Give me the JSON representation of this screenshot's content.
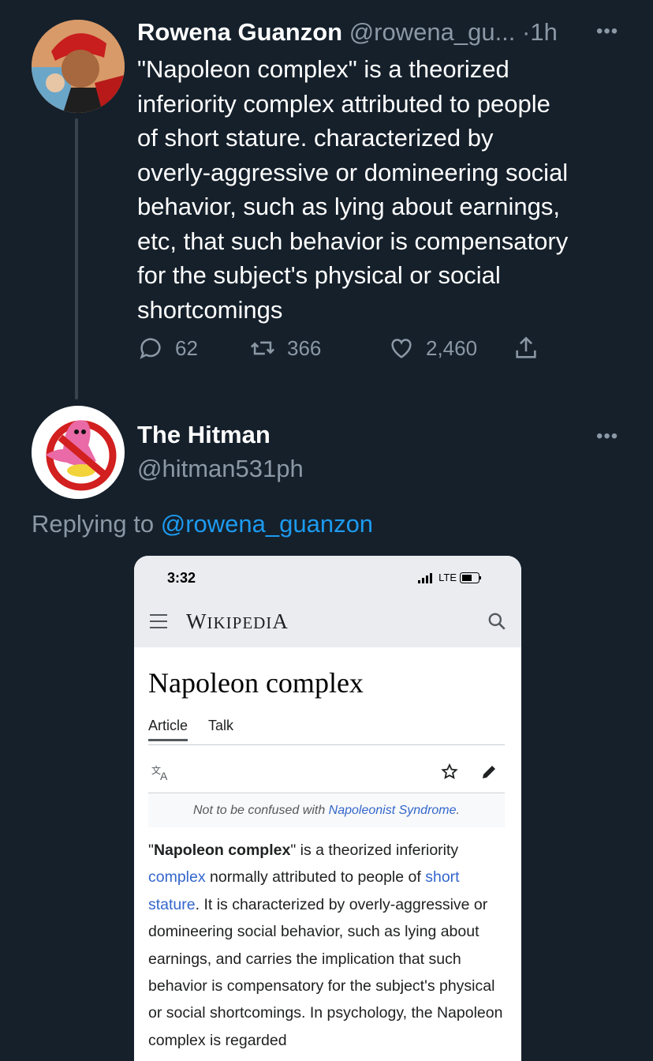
{
  "tweet": {
    "author_name": "Rowena Guanzon",
    "author_handle": "@rowena_gu...",
    "separator": "·",
    "time": "1h",
    "more": "•••",
    "text": "\"Napoleon complex\" is a theorized\ninferiority complex attributed to people\nof short stature.  characterized by\noverly-aggressive or domineering social\nbehavior, such as lying about earnings,\netc, that such behavior is compensatory\nfor the subject's physical or social\nshortcomings",
    "actions": {
      "replies": "62",
      "retweets": "366",
      "likes": "2,460"
    }
  },
  "reply": {
    "author_name": "The Hitman",
    "author_handle": "@hitman531ph",
    "more": "•••",
    "replying_prefix": "Replying to",
    "replying_handle": "@rowena_guanzon"
  },
  "embedded_screenshot": {
    "status_time": "3:32",
    "network": "LTE",
    "wiki_logo_first": "W",
    "wiki_logo_rest": "IKIPEDI",
    "wiki_logo_last": "A",
    "article_title": "Napoleon complex",
    "tabs": [
      "Article",
      "Talk"
    ],
    "hatnote_prefix": "Not to be confused with ",
    "hatnote_link": "Napoleonist Syndrome",
    "hatnote_suffix": ".",
    "para": {
      "q1": "\"",
      "bold": "Napoleon complex",
      "t1": "\" is a theorized inferiority ",
      "link1": "complex",
      "t2": " normally attributed to people of ",
      "link2": "short stature",
      "t3": ". It is characterized by overly-aggressive or domineering social behavior, such as lying about earnings, and carries the implication that such behavior is compensatory for the subject's physical or social shortcomings. In psychology, the Napoleon complex is regarded"
    }
  },
  "colors": {
    "background": "#15202b",
    "muted": "#8b98a5",
    "link": "#1d9bf0",
    "wiki_link": "#3366cc"
  }
}
